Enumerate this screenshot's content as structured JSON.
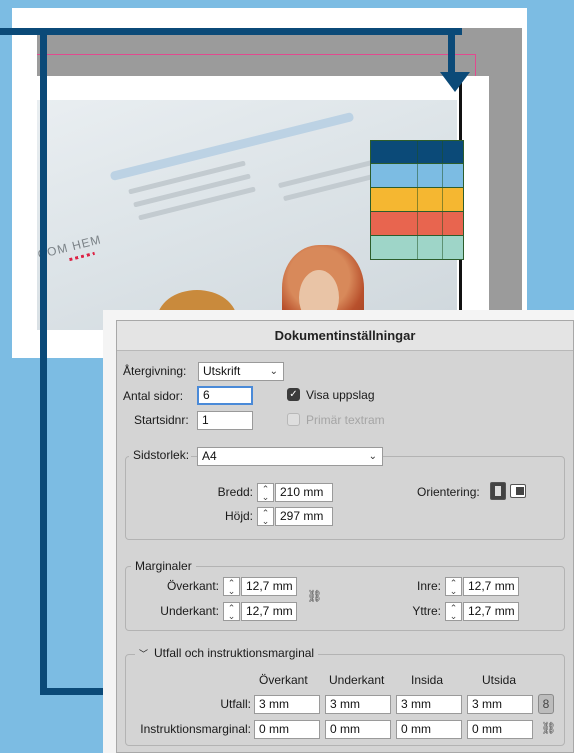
{
  "dialog": {
    "title": "Dokumentinställningar",
    "rendering_label": "Återgivning:",
    "rendering_value": "Utskrift",
    "num_pages_label": "Antal sidor:",
    "num_pages_value": "6",
    "start_page_label": "Startsidnr:",
    "start_page_value": "1",
    "facing_pages_label": "Visa uppslag",
    "facing_pages_checked": true,
    "primary_textframe_label": "Primär textram",
    "primary_textframe_checked": false
  },
  "page_size": {
    "label": "Sidstorlek:",
    "value": "A4",
    "width_label": "Bredd:",
    "width_value": "210 mm",
    "height_label": "Höjd:",
    "height_value": "297 mm",
    "orientation_label": "Orientering:"
  },
  "margins": {
    "title": "Marginaler",
    "top_label": "Överkant:",
    "top_value": "12,7 mm",
    "bottom_label": "Underkant:",
    "bottom_value": "12,7 mm",
    "inside_label": "Inre:",
    "inside_value": "12,7 mm",
    "outside_label": "Yttre:",
    "outside_value": "12,7 mm"
  },
  "bleed": {
    "title": "Utfall och instruktionsmarginal",
    "columns": [
      "Överkant",
      "Underkant",
      "Insida",
      "Utsida"
    ],
    "bleed_label": "Utfall:",
    "bleed_values": [
      "3 mm",
      "3 mm",
      "3 mm",
      "3 mm"
    ],
    "slug_label": "Instruktionsmarginal:",
    "slug_values": [
      "0 mm",
      "0 mm",
      "0 mm",
      "0 mm"
    ]
  },
  "colors": {
    "background": "#7cbce3",
    "arrow": "#0b4a78",
    "swatches": [
      "#0b4a78",
      "#7cbce3",
      "#f5b731",
      "#e8654f",
      "#9ed5c8"
    ]
  }
}
